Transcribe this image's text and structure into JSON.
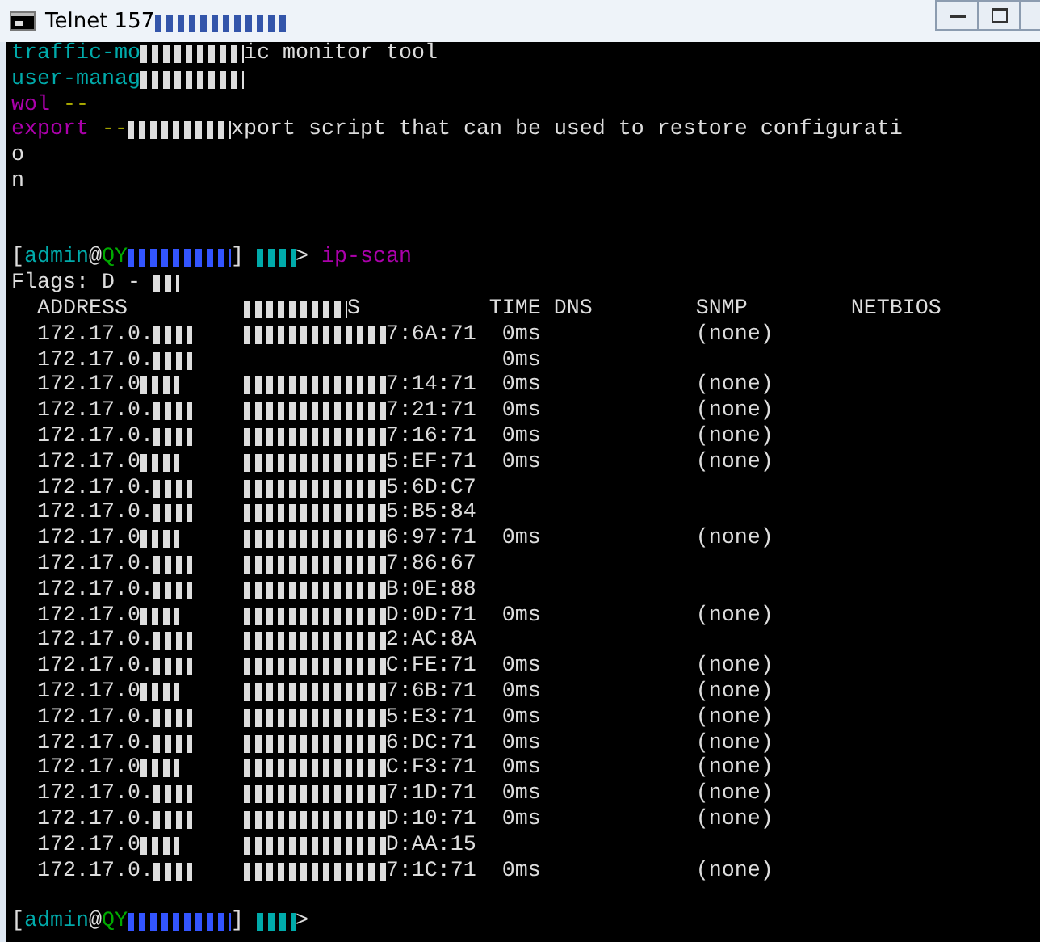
{
  "window": {
    "title": "Telnet 157"
  },
  "output_lines": [
    [
      {
        "text": "traffic-mo",
        "color": "#00aaaa"
      },
      {
        "kind": "redacted"
      },
      {
        "text": "ic monitor tool",
        "color": "#dddddd"
      }
    ],
    [
      {
        "text": "user-manag",
        "color": "#00aaaa"
      },
      {
        "kind": "redacted"
      }
    ],
    [
      {
        "text": "wol",
        "color": "#aa00aa"
      },
      {
        "text": " --",
        "color": "#aaaa00"
      }
    ],
    [
      {
        "text": "export",
        "color": "#aa00aa"
      },
      {
        "text": " --",
        "color": "#aaaa00"
      },
      {
        "kind": "redacted"
      },
      {
        "text": "xport script that can be used to restore configurati",
        "color": "#dddddd"
      }
    ],
    [
      {
        "text": "o",
        "color": "#dddddd"
      }
    ],
    [
      {
        "text": "n",
        "color": "#dddddd"
      }
    ]
  ],
  "command_prompt": [
    {
      "text": "[",
      "color": "#dddddd"
    },
    {
      "text": "admin",
      "color": "#00aaaa"
    },
    {
      "text": "@",
      "color": "#dddddd"
    },
    {
      "text": "QY",
      "color": "#00aa00"
    },
    {
      "kind": "redacted",
      "color": "#3355ff"
    },
    {
      "text": "] ",
      "color": "#dddddd"
    },
    {
      "kind": "redacted",
      "color": "#00aaaa"
    },
    {
      "text": "> ",
      "color": "#dddddd"
    },
    {
      "text": "ip-scan",
      "color": "#aa00aa"
    }
  ],
  "flags": "Flags: D - ",
  "columns": [
    {
      "label": "ADDRESS"
    },
    {
      "label": "S",
      "redacted": true
    },
    {
      "label": "TIME"
    },
    {
      "label": "DNS"
    },
    {
      "label": "SNMP"
    },
    {
      "label": "NETBIOS"
    }
  ],
  "rows": [
    {
      "address": "172.17.0.",
      "mac": "7:6A:71",
      "time": "0ms",
      "snmp": "(none)"
    },
    {
      "address": "172.17.0.",
      "time": "0ms"
    },
    {
      "address": "172.17.0",
      "mac": "7:14:71",
      "time": "0ms",
      "snmp": "(none)"
    },
    {
      "address": "172.17.0.",
      "mac": "7:21:71",
      "time": "0ms",
      "snmp": "(none)"
    },
    {
      "address": "172.17.0.",
      "mac": "7:16:71",
      "time": "0ms",
      "snmp": "(none)"
    },
    {
      "address": "172.17.0",
      "mac": "5:EF:71",
      "time": "0ms",
      "snmp": "(none)"
    },
    {
      "address": "172.17.0.",
      "mac": "5:6D:C7"
    },
    {
      "address": "172.17.0.",
      "mac": "5:B5:84"
    },
    {
      "address": "172.17.0",
      "mac": "6:97:71",
      "time": "0ms",
      "snmp": "(none)"
    },
    {
      "address": "172.17.0.",
      "mac": "7:86:67"
    },
    {
      "address": "172.17.0.",
      "mac": "B:0E:88"
    },
    {
      "address": "172.17.0",
      "mac": "D:0D:71",
      "time": "0ms",
      "snmp": "(none)"
    },
    {
      "address": "172.17.0.",
      "mac": "2:AC:8A"
    },
    {
      "address": "172.17.0.",
      "mac": "C:FE:71",
      "time": "0ms",
      "snmp": "(none)"
    },
    {
      "address": "172.17.0",
      "mac": "7:6B:71",
      "time": "0ms",
      "snmp": "(none)"
    },
    {
      "address": "172.17.0.",
      "mac": "5:E3:71",
      "time": "0ms",
      "snmp": "(none)"
    },
    {
      "address": "172.17.0.",
      "mac": "6:DC:71",
      "time": "0ms",
      "snmp": "(none)"
    },
    {
      "address": "172.17.0",
      "mac": "C:F3:71",
      "time": "0ms",
      "snmp": "(none)"
    },
    {
      "address": "172.17.0.",
      "mac": "7:1D:71",
      "time": "0ms",
      "snmp": "(none)"
    },
    {
      "address": "172.17.0.",
      "mac": "D:10:71",
      "time": "0ms",
      "snmp": "(none)"
    },
    {
      "address": "172.17.0",
      "mac": "D:AA:15"
    },
    {
      "address": "172.17.0.",
      "mac": "7:1C:71",
      "time": "0ms",
      "snmp": "(none)"
    }
  ],
  "final_prompt": [
    {
      "text": "[",
      "color": "#dddddd"
    },
    {
      "text": "admin",
      "color": "#00aaaa"
    },
    {
      "text": "@",
      "color": "#dddddd"
    },
    {
      "text": "QY",
      "color": "#00aa00"
    },
    {
      "kind": "redacted",
      "color": "#3355ff"
    },
    {
      "text": "] ",
      "color": "#dddddd"
    },
    {
      "kind": "redacted",
      "color": "#00aaaa"
    },
    {
      "text": ">",
      "color": "#dddddd"
    }
  ]
}
